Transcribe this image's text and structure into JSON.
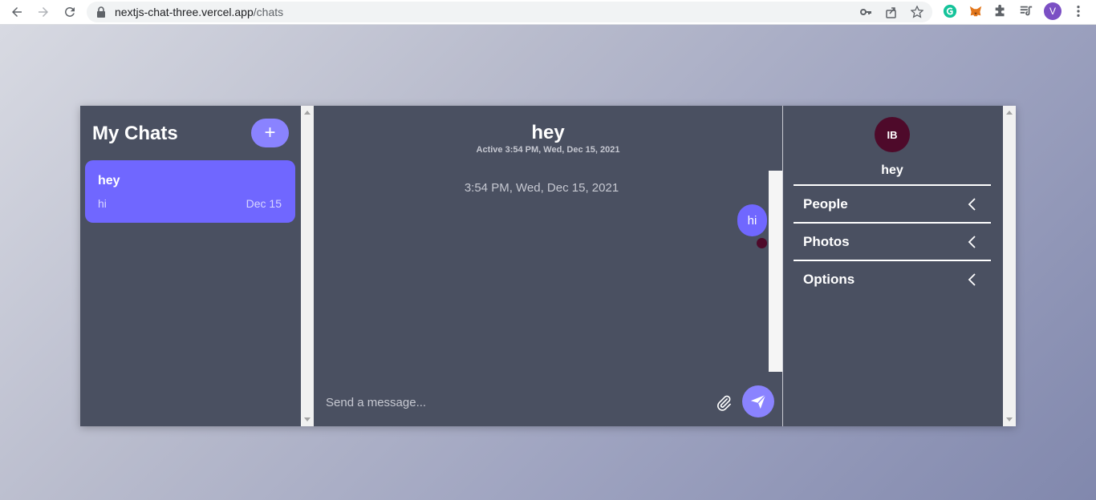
{
  "browser": {
    "url_host": "nextjs-chat-three.vercel.app",
    "url_path": "/chats",
    "profile_initial": "V"
  },
  "sidebar": {
    "title": "My Chats",
    "new_chat_label": "+",
    "chats": [
      {
        "title": "hey",
        "preview": "hi",
        "date": "Dec 15"
      }
    ]
  },
  "chat": {
    "title": "hey",
    "subtitle": "Active 3:54 PM, Wed, Dec 15, 2021",
    "timestamp": "3:54 PM, Wed, Dec 15, 2021",
    "messages": [
      {
        "text": "hi"
      }
    ],
    "input_placeholder": "Send a message...",
    "input_value": ""
  },
  "details": {
    "avatar_initials": "IB",
    "name": "hey",
    "sections": [
      {
        "label": "People"
      },
      {
        "label": "Photos"
      },
      {
        "label": "Options"
      }
    ]
  },
  "colors": {
    "panel": "#4a5061",
    "accent": "#7067ff",
    "accent_light": "#8a83ff",
    "avatar": "#4e0a2a"
  }
}
